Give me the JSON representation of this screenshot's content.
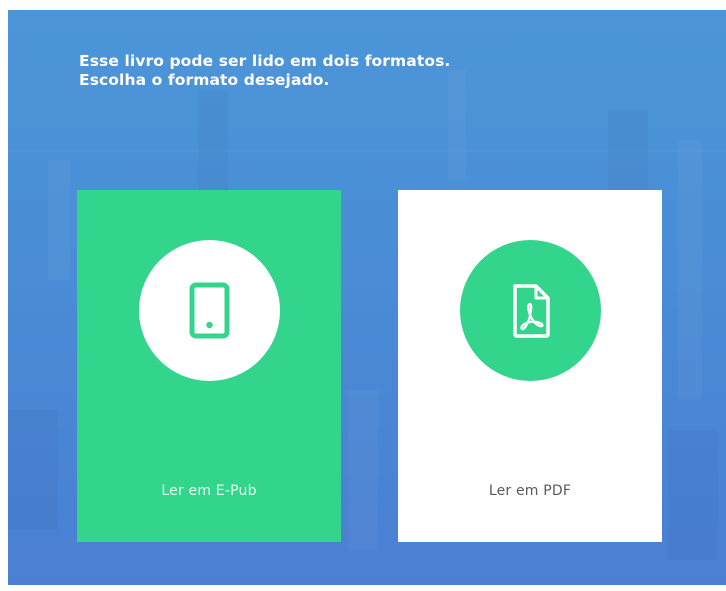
{
  "prompt": {
    "line1": "Esse livro pode ser lido em dois formatos.",
    "line2": "Escolha o formato desejado."
  },
  "options": [
    {
      "label": "Ler em E-Pub",
      "icon": "tablet-icon"
    },
    {
      "label": "Ler em PDF",
      "icon": "pdf-file-icon"
    }
  ],
  "colors": {
    "background_gradient_top": "#4d95d8",
    "background_gradient_bottom": "#4b7fd2",
    "accent_green": "#33d48b",
    "card_white": "#ffffff",
    "heading_text": "#ffffff",
    "pdf_label_text": "#5a5a5a"
  }
}
